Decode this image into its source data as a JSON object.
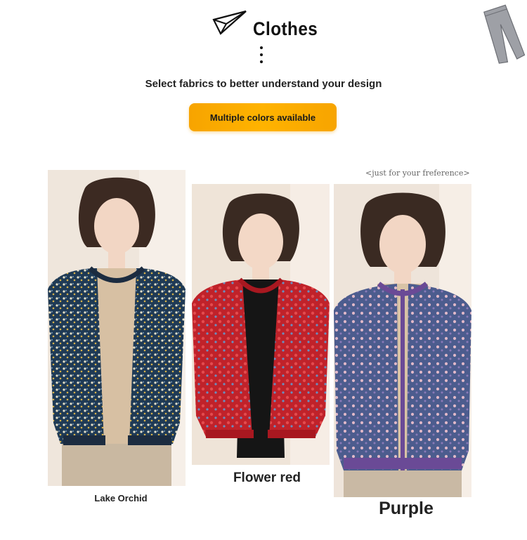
{
  "header": {
    "title": "Clothes",
    "subtitle": "Select fabrics to better understand your design",
    "badge_label": "Multiple colors available"
  },
  "hint": "<just for your freference>",
  "products": [
    {
      "label": "Lake Orchid",
      "color": "#1f3a55",
      "accent": "#e8e2c8"
    },
    {
      "label": "Flower red",
      "color": "#c0222a",
      "accent": "#6a8fc0"
    },
    {
      "label": "Purple",
      "color": "#5a4a8a",
      "accent": "#e0b8c8"
    }
  ],
  "icons": [
    "paper-plane-icon",
    "pants-icon"
  ]
}
